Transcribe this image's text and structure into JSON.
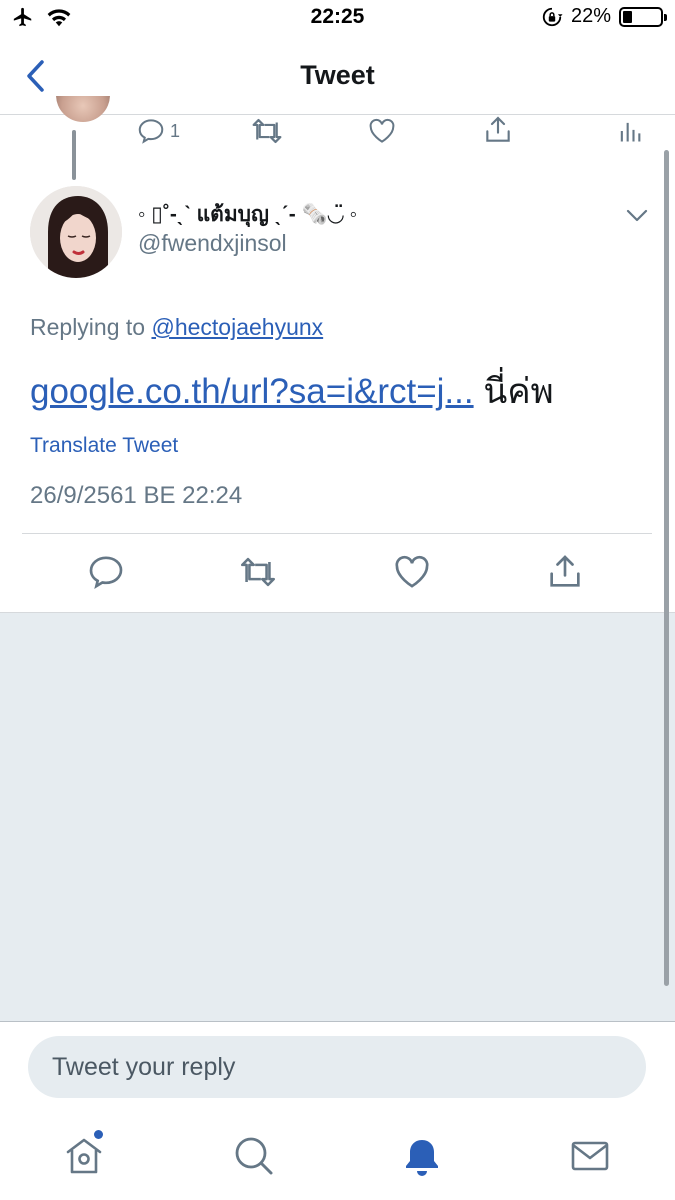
{
  "status_bar": {
    "time": "22:25",
    "battery_percent": "22%",
    "battery_level": 0.22,
    "icons": [
      "airplane-icon",
      "wifi-icon",
      "rotation-lock-icon",
      "battery-icon"
    ]
  },
  "header": {
    "title": "Tweet",
    "back_icon": "chevron-left-icon"
  },
  "previous_tweet": {
    "reply_count": "1",
    "actions": [
      "reply-icon",
      "retweet-icon",
      "like-icon",
      "share-icon",
      "analytics-icon"
    ]
  },
  "tweet": {
    "display_name": "◦ ▯˚-ˎˋ แต้มบุญ ˎˊ- 🗞️◡̈ ◦",
    "handle": "@fwendxjinsol",
    "replying_prefix": "Replying to ",
    "replying_to": "@hectojaehyunx",
    "link_text": "google.co.th/url?sa=i&rct=j...",
    "text_suffix": " นี่ค่พ",
    "translate_label": "Translate Tweet",
    "timestamp": "26/9/2561 BE 22:24",
    "actions": [
      "reply-icon",
      "retweet-icon",
      "like-icon",
      "share-icon"
    ]
  },
  "reply": {
    "placeholder": "Tweet your reply"
  },
  "tabbar": {
    "items": [
      "home-icon",
      "search-icon",
      "notifications-icon",
      "messages-icon"
    ],
    "active": "notifications-icon",
    "accent_color": "#2b5fb7"
  },
  "colors": {
    "link": "#2b5fb7",
    "secondary_text": "#657786",
    "background_gray": "#e6ecf0"
  }
}
